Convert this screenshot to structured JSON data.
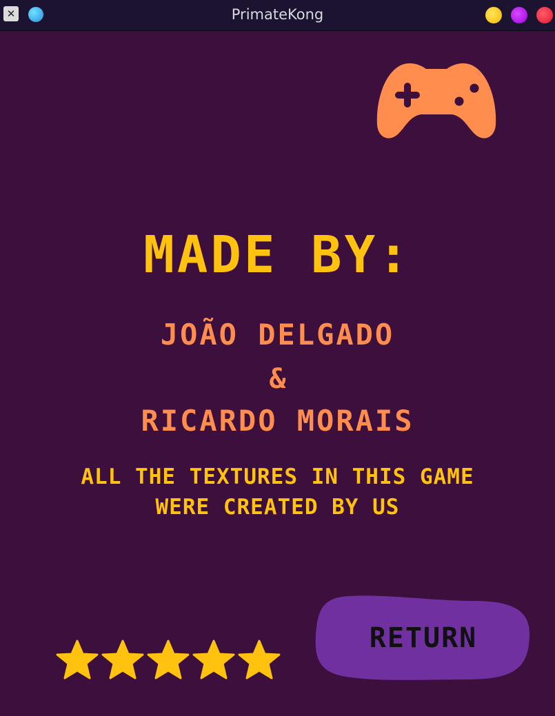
{
  "window": {
    "title": "PrimateKong",
    "app_icon": "x11-icon",
    "controls": [
      "minimize-button",
      "maximize-button",
      "close-button"
    ]
  },
  "credits": {
    "heading": "MADE BY:",
    "author_1": "JOÃO DELGADO",
    "separator": "&",
    "author_2": "RiCARDO MORAiS",
    "note_line_1": "ALL THE TEXTURES iN THiS GAME",
    "note_line_2": "WERE CREATED BY US"
  },
  "decor": {
    "gamepad_icon": "gamepad-icon",
    "stars": 5,
    "stars_max": 5
  },
  "buttons": {
    "return_label": "RETURN"
  },
  "colors": {
    "background": "#3d0f3c",
    "heading": "#ffc20e",
    "names": "#ff8d4d",
    "gamepad": "#ff8d4d",
    "button": "#7030a0",
    "stars": "#ffc20e"
  }
}
